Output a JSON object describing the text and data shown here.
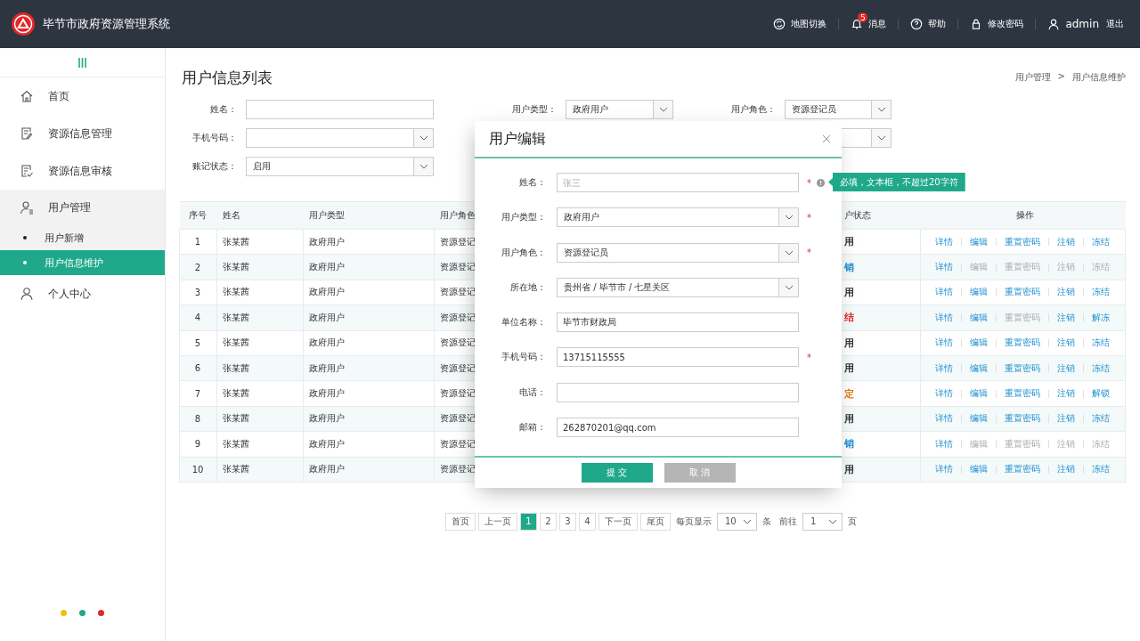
{
  "header": {
    "title": "毕节市政府资源管理系统",
    "actions": [
      {
        "kind": "map",
        "label": "地图切换"
      },
      {
        "kind": "bell",
        "label": "消息",
        "badge": "5"
      },
      {
        "kind": "help",
        "label": "帮助"
      },
      {
        "kind": "lock",
        "label": "修改密码"
      },
      {
        "kind": "user",
        "label": "admin"
      }
    ],
    "logout": "退出"
  },
  "sidebar": {
    "items": [
      {
        "label": "首页",
        "expanded": false
      },
      {
        "label": "资源信息管理",
        "expanded": false
      },
      {
        "label": "资源信息审核",
        "expanded": false
      },
      {
        "label": "用户管理",
        "expanded": true,
        "children": [
          {
            "label": "用户新增",
            "selected": false
          },
          {
            "label": "用户信息维护",
            "selected": true
          }
        ]
      },
      {
        "label": "个人中心",
        "expanded": false
      }
    ],
    "dots": [
      {
        "color": "#f2c200"
      },
      {
        "color": "#1fa98a"
      },
      {
        "color": "#e5262b"
      }
    ]
  },
  "page_title": "用户信息列表",
  "breadcrumb": [
    {
      "label": "用户管理"
    },
    {
      "separator": ">",
      "label": "用户信息维护"
    }
  ],
  "filter_rows": [
    [
      {
        "kind": "input",
        "label": "姓名："
      },
      {
        "kind": "select",
        "label": "用户类型：",
        "value": "政府用户"
      },
      {
        "kind": "select",
        "label": "用户角色：",
        "value": "资源登记员"
      }
    ],
    [
      {
        "kind": "select",
        "label": "手机号码："
      },
      {
        "kind": "partial-select"
      }
    ],
    [
      {
        "kind": "select",
        "label": "账记状态：",
        "value": "启用"
      }
    ]
  ],
  "table": {
    "columns": [
      "序号",
      "姓名",
      "用户类型",
      "用户角色",
      null,
      "户状态",
      "操作"
    ],
    "rows": [
      {
        "no": "1",
        "name": "张某茜",
        "type": "政府用户",
        "role": "资源登记",
        "status": "用",
        "color": "#333333",
        "actions": [
          {
            "label": "详情",
            "disabled": false
          },
          {
            "label": "编辑",
            "disabled": false
          },
          {
            "label": "重置密码",
            "disabled": false
          },
          {
            "label": "注销",
            "disabled": false
          },
          {
            "label": "冻结",
            "disabled": false
          }
        ]
      },
      {
        "no": "2",
        "name": "张某茜",
        "type": "政府用户",
        "role": "资源登记",
        "status": "销",
        "color": "#1d8fcf",
        "actions": [
          {
            "label": "详情",
            "disabled": false
          },
          {
            "label": "编辑",
            "disabled": true
          },
          {
            "label": "重置密码",
            "disabled": true
          },
          {
            "label": "注销",
            "disabled": true
          },
          {
            "label": "冻结",
            "disabled": true
          }
        ]
      },
      {
        "no": "3",
        "name": "张某茜",
        "type": "政府用户",
        "role": "资源登记",
        "status": "用",
        "color": "#333333",
        "actions": [
          {
            "label": "详情",
            "disabled": false
          },
          {
            "label": "编辑",
            "disabled": false
          },
          {
            "label": "重置密码",
            "disabled": false
          },
          {
            "label": "注销",
            "disabled": false
          },
          {
            "label": "冻结",
            "disabled": false
          }
        ]
      },
      {
        "no": "4",
        "name": "张某茜",
        "type": "政府用户",
        "role": "资源登记",
        "status": "结",
        "color": "#e5262b",
        "actions": [
          {
            "label": "详情",
            "disabled": false
          },
          {
            "label": "编辑",
            "disabled": false
          },
          {
            "label": "重置密码",
            "disabled": true
          },
          {
            "label": "注销",
            "disabled": false
          },
          {
            "label": "解冻",
            "disabled": false
          }
        ]
      },
      {
        "no": "5",
        "name": "张某茜",
        "type": "政府用户",
        "role": "资源登记",
        "status": "用",
        "color": "#333333",
        "actions": [
          {
            "label": "详情",
            "disabled": false
          },
          {
            "label": "编辑",
            "disabled": false
          },
          {
            "label": "重置密码",
            "disabled": false
          },
          {
            "label": "注销",
            "disabled": false
          },
          {
            "label": "冻结",
            "disabled": false
          }
        ]
      },
      {
        "no": "6",
        "name": "张某茜",
        "type": "政府用户",
        "role": "资源登记",
        "status": "用",
        "color": "#333333",
        "actions": [
          {
            "label": "详情",
            "disabled": false
          },
          {
            "label": "编辑",
            "disabled": false
          },
          {
            "label": "重置密码",
            "disabled": false
          },
          {
            "label": "注销",
            "disabled": false
          },
          {
            "label": "冻结",
            "disabled": false
          }
        ]
      },
      {
        "no": "7",
        "name": "张某茜",
        "type": "政府用户",
        "role": "资源登记",
        "status": "定",
        "color": "#e07a10",
        "actions": [
          {
            "label": "详情",
            "disabled": false
          },
          {
            "label": "编辑",
            "disabled": false
          },
          {
            "label": "重置密码",
            "disabled": false
          },
          {
            "label": "注销",
            "disabled": false
          },
          {
            "label": "解锁",
            "disabled": false
          }
        ]
      },
      {
        "no": "8",
        "name": "张某茜",
        "type": "政府用户",
        "role": "资源登记",
        "status": "用",
        "color": "#333333",
        "actions": [
          {
            "label": "详情",
            "disabled": false
          },
          {
            "label": "编辑",
            "disabled": false
          },
          {
            "label": "重置密码",
            "disabled": false
          },
          {
            "label": "注销",
            "disabled": false
          },
          {
            "label": "冻结",
            "disabled": false
          }
        ]
      },
      {
        "no": "9",
        "name": "张某茜",
        "type": "政府用户",
        "role": "资源登记",
        "status": "销",
        "color": "#1d8fcf",
        "actions": [
          {
            "label": "详情",
            "disabled": false
          },
          {
            "label": "编辑",
            "disabled": true
          },
          {
            "label": "重置密码",
            "disabled": true
          },
          {
            "label": "注销",
            "disabled": true
          },
          {
            "label": "冻结",
            "disabled": true
          }
        ]
      },
      {
        "no": "10",
        "name": "张某茜",
        "type": "政府用户",
        "role": "资源登记",
        "status": "用",
        "color": "#333333",
        "actions": [
          {
            "label": "详情",
            "disabled": false
          },
          {
            "label": "编辑",
            "disabled": false
          },
          {
            "label": "重置密码",
            "disabled": false
          },
          {
            "label": "注销",
            "disabled": false
          },
          {
            "label": "冻结",
            "disabled": false
          }
        ]
      }
    ]
  },
  "pagination": {
    "first": "首页",
    "prev": "上一页",
    "pages": [
      {
        "label": "1",
        "selected": true
      },
      {
        "label": "2",
        "selected": false
      },
      {
        "label": "3",
        "selected": false
      },
      {
        "label": "4",
        "selected": false
      }
    ],
    "next": "下一页",
    "last": "尾页",
    "per_page_label": "每页显示",
    "per_page": "10",
    "unit": "条",
    "goto_label": "前往",
    "goto": "1",
    "page_unit": "页"
  },
  "dialog": {
    "title": "用户编辑",
    "fields": [
      {
        "kind": "input",
        "label": "姓名：",
        "placeholder": "张三",
        "mark": "*",
        "hint": "必填，文本框，不超过20字符"
      },
      {
        "kind": "select",
        "label": "用户类型：",
        "value": "政府用户",
        "mark": "*"
      },
      {
        "kind": "select",
        "label": "用户角色：",
        "value": "资源登记员",
        "mark": "*"
      },
      {
        "kind": "select",
        "label": "所在地：",
        "value": "贵州省 / 毕节市 / 七星关区"
      },
      {
        "kind": "input",
        "label": "单位名称：",
        "value": "毕节市财政局"
      },
      {
        "kind": "input",
        "label": "手机号码：",
        "value": "13715115555",
        "mark": "*"
      },
      {
        "kind": "input",
        "label": "电话："
      },
      {
        "kind": "input",
        "label": "邮箱：",
        "value": "262870201@qq.com"
      }
    ],
    "submit": "提 交",
    "cancel": "取 消"
  }
}
